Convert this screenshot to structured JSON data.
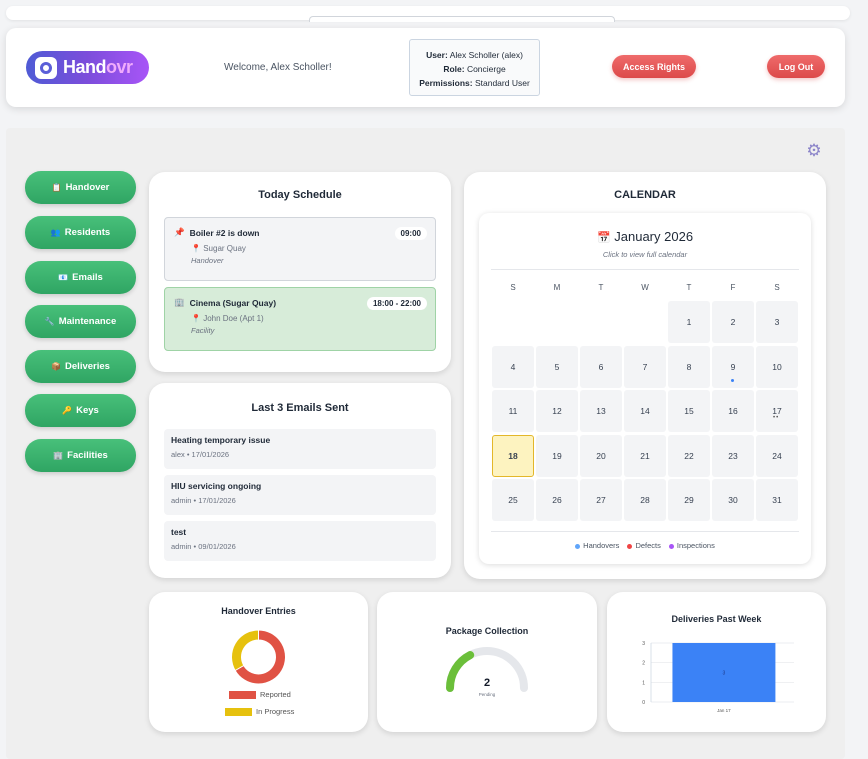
{
  "header": {
    "brand_part1": "Hand",
    "brand_part2": "ovr",
    "welcome": "Welcome, Alex Scholler!",
    "user_label": "User:",
    "user_value": "Alex Scholler (alex)",
    "role_label": "Role:",
    "role_value": "Concierge",
    "perm_label": "Permissions:",
    "perm_value": "Standard User",
    "access_rights": "Access Rights",
    "logout": "Log Out"
  },
  "sidebar": {
    "items": [
      {
        "icon": "📋",
        "label": "Handover"
      },
      {
        "icon": "👥",
        "label": "Residents"
      },
      {
        "icon": "📧",
        "label": "Emails"
      },
      {
        "icon": "🔧",
        "label": "Maintenance"
      },
      {
        "icon": "📦",
        "label": "Deliveries"
      },
      {
        "icon": "🔑",
        "label": "Keys"
      },
      {
        "icon": "🏢",
        "label": "Facilities"
      }
    ]
  },
  "schedule": {
    "title": "Today Schedule",
    "events": [
      {
        "icon": "📌",
        "title": "Boiler #2 is down",
        "time": "09:00",
        "location": "Sugar Quay",
        "category": "Handover"
      },
      {
        "icon": "🏢",
        "title": "Cinema (Sugar Quay)",
        "time": "18:00 - 22:00",
        "location": "John Doe (Apt 1)",
        "category": "Facility"
      }
    ]
  },
  "emails": {
    "title": "Last 3 Emails Sent",
    "items": [
      {
        "subject": "Heating temporary issue",
        "meta": "alex • 17/01/2026"
      },
      {
        "subject": "HIU servicing ongoing",
        "meta": "admin • 17/01/2026"
      },
      {
        "subject": "test",
        "meta": "admin • 09/01/2026"
      }
    ]
  },
  "calendar": {
    "title": "CALENDAR",
    "month": "January 2026",
    "subtitle": "Click to view full calendar",
    "weekdays": [
      "S",
      "M",
      "T",
      "W",
      "T",
      "F",
      "S"
    ],
    "today": "18",
    "legend": [
      {
        "label": "Handovers",
        "color": "#60a5fa"
      },
      {
        "label": "Defects",
        "color": "#ef4444"
      },
      {
        "label": "Inspections",
        "color": "#a855f7"
      }
    ]
  },
  "widgets": {
    "handover_title": "Handover Entries",
    "package_title": "Package Collection",
    "package_value": "2",
    "package_label": "Pending",
    "deliveries_title": "Deliveries Past Week"
  },
  "chart_data": [
    {
      "type": "pie",
      "title": "Handover Entries",
      "categories": [
        "Reported",
        "In Progress"
      ],
      "values": [
        2,
        1
      ],
      "colors": [
        "#e05244",
        "#e6c10e"
      ]
    },
    {
      "type": "gauge",
      "title": "Package Collection",
      "value": 2,
      "label": "Pending",
      "fraction": 0.35,
      "colors": [
        "#6bbf3a",
        "#e5e7eb"
      ]
    },
    {
      "type": "bar",
      "title": "Deliveries Past Week",
      "categories": [
        "Jan 17"
      ],
      "values": [
        3
      ],
      "ylim": [
        0,
        3
      ],
      "yticks": [
        "0",
        "1",
        "2",
        "3"
      ],
      "color": "#3b82f6"
    }
  ]
}
